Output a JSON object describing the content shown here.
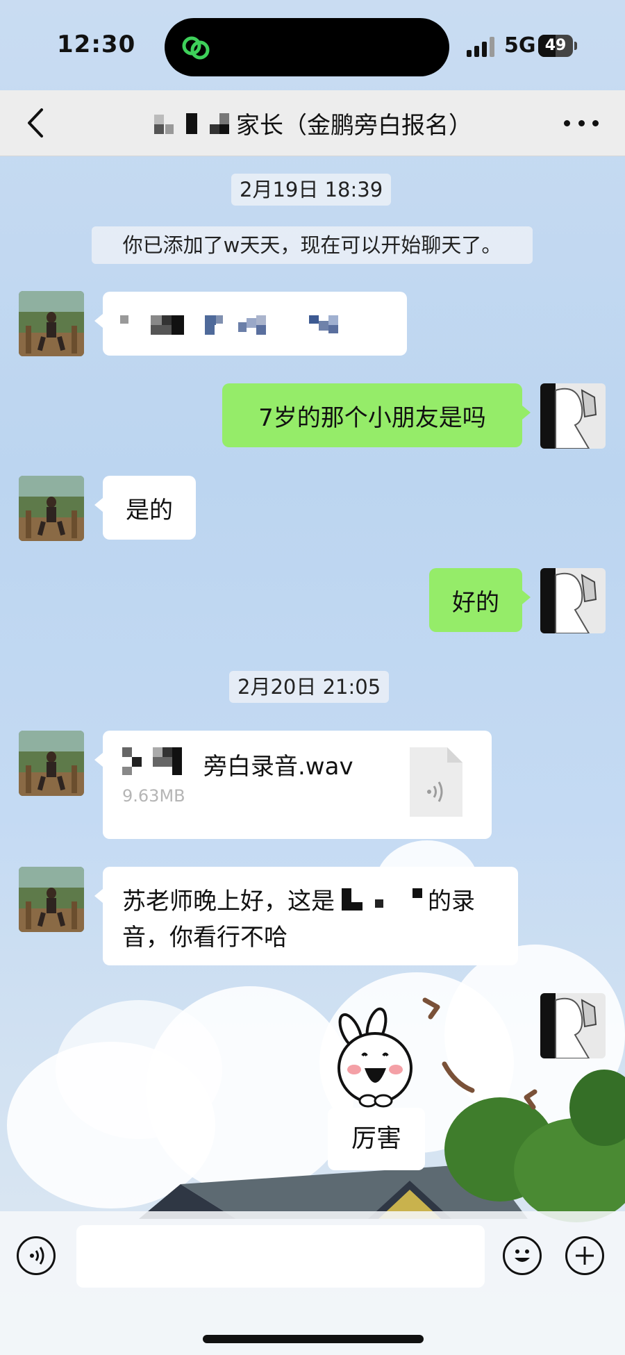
{
  "status_bar": {
    "time": "12:30",
    "network": "5G",
    "battery": "49"
  },
  "nav": {
    "title": "家长（金鹏旁白报名）"
  },
  "messages": {
    "timestamp_1": "2月19日 18:39",
    "system_notice": "你已添加了w天天，现在可以开始聊天了。",
    "reply_1": "7岁的那个小朋友是吗",
    "reply_2": "是的",
    "reply_3": "好的",
    "timestamp_2": "2月20日 21:05",
    "file_name": "旁白录音.wav",
    "file_size": "9.63MB",
    "voice_note_line1_a": "苏老师晚上好，这是",
    "voice_note_line1_b": "的录",
    "voice_note_line2": "音，你看行不哈",
    "sticker_caption": "厉害"
  },
  "colors": {
    "sent_bubble": "#95ec69",
    "received_bubble": "#ffffff",
    "nav_background": "#ededed"
  }
}
